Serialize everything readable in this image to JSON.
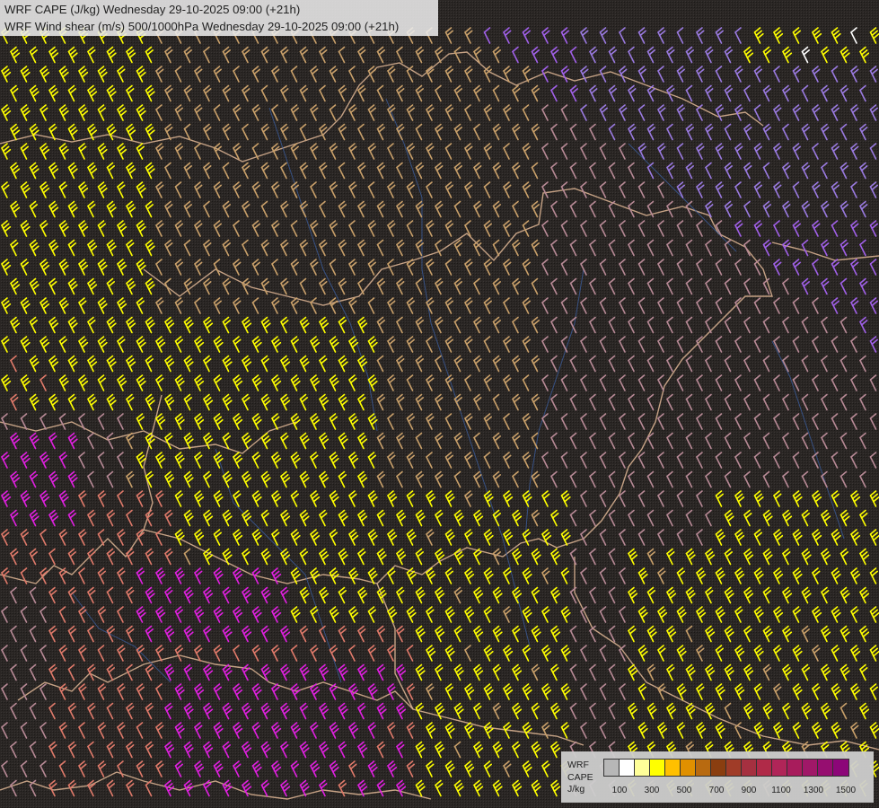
{
  "header": {
    "line1": "WRF CAPE (J/kg) Wednesday 29-10-2025 09:00 (+21h)",
    "line2": "WRF Wind shear (m/s) 500/1000hPa Wednesday 29-10-2025 09:00 (+21h)"
  },
  "legend": {
    "caption": [
      "WRF",
      "CAPE",
      "J/kg"
    ],
    "swatch_colors": [
      "#b7b7b7",
      "#ffffff",
      "#ffff99",
      "#ffff00",
      "#ffc000",
      "#e09000",
      "#b86a10",
      "#8a3e10",
      "#a03c28",
      "#a53040",
      "#b02a48",
      "#b02558",
      "#a81c5c",
      "#a01868",
      "#960e70",
      "#8c0678"
    ],
    "ticks": [
      "100",
      "300",
      "500",
      "700",
      "900",
      "1100",
      "1300",
      "1500"
    ]
  },
  "barb_colors": {
    "yellow": "#ffff00",
    "tan": "#c9a06a",
    "salmon": "#e07a6a",
    "magenta": "#e020e0",
    "purple": "#a060e8",
    "mauve": "#b88a96",
    "lavender": "#9a7ae0",
    "white": "#ffffff"
  },
  "line_colors": {
    "border": "#e2b896",
    "river": "#3b5c9c"
  },
  "icons": [
    "wind-barb-icon"
  ]
}
